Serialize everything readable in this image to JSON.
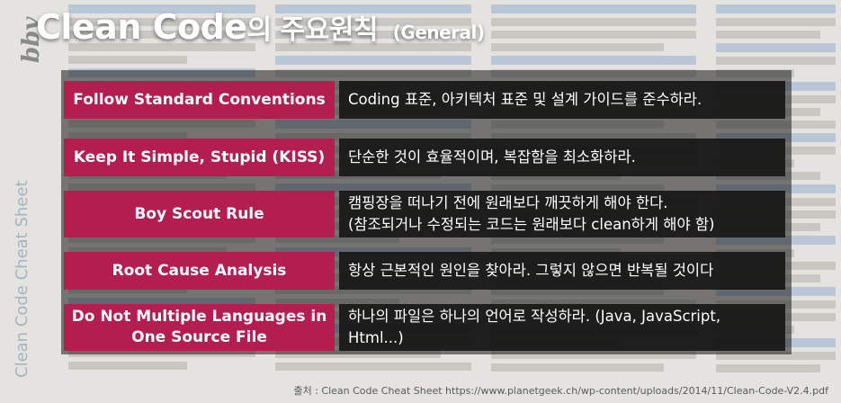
{
  "title": {
    "main": "Clean Code",
    "korean": "의 주요원칙",
    "sub": "(General)"
  },
  "principles": [
    {
      "name": "Follow Standard Conventions",
      "desc": [
        "Coding 표준, 아키텍처 표준 및 설계 가이드를 준수하라."
      ]
    },
    {
      "name": "Keep It Simple, Stupid (KISS)",
      "desc": [
        "단순한 것이 효율적이며, 복잡함을 최소화하라."
      ]
    },
    {
      "name": "Boy Scout Rule",
      "desc": [
        "캠핑장을 떠나기 전에 원래보다 깨끗하게 해야 한다.",
        "(참조되거나 수정되는 코드는 원래보다 clean하게 해야 함)"
      ]
    },
    {
      "name": "Root Cause Analysis",
      "desc": [
        "항상 근본적인 원인을 찾아라. 그렇지 않으면 반복될 것이다"
      ]
    },
    {
      "name_lines": [
        "Do Not Multiple Languages in",
        "One Source File"
      ],
      "desc": [
        "하나의 파일은 하나의 언어로 작성하라. (Java, JavaScript,",
        "Html...)"
      ]
    }
  ],
  "backdrop": {
    "logo": "bbv",
    "side_title": "Clean Code Cheat Sheet"
  },
  "source": "출처 : Clean Code Cheat Sheet https://www.planetgeek.ch/wp-content/uploads/2014/11/Clean-Code-V2.4.pdf",
  "colors": {
    "label_bg": "#b31d4f",
    "desc_bg": "#121212",
    "text": "#ffffff"
  }
}
